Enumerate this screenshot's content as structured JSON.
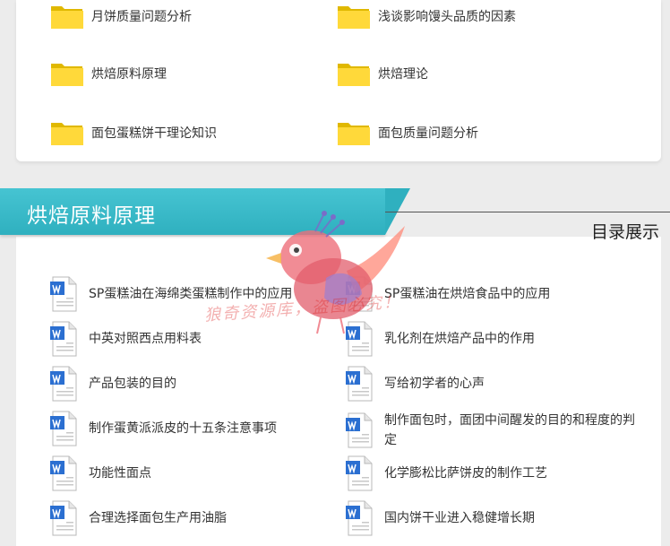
{
  "top_folders": [
    {
      "label": "月饼质量问题分析",
      "icon": "folder-icon"
    },
    {
      "label": "浅谈影响馒头品质的因素",
      "icon": "folder-icon"
    },
    {
      "label": "烘焙原料原理",
      "icon": "folder-icon"
    },
    {
      "label": "烘焙理论",
      "icon": "folder-icon"
    },
    {
      "label": "面包蛋糕饼干理论知识",
      "icon": "folder-icon"
    },
    {
      "label": "面包质量问题分析",
      "icon": "folder-icon"
    }
  ],
  "section": {
    "title": "烘焙原料原理",
    "subtitle": "目录展示",
    "accent": "#3bbbc9"
  },
  "docs": [
    {
      "label": "SP蛋糕油在海绵类蛋糕制作中的应用",
      "icon": "word-doc-icon"
    },
    {
      "label": "SP蛋糕油在烘焙食品中的应用",
      "icon": "word-doc-icon"
    },
    {
      "label": "中英对照西点用料表",
      "icon": "word-doc-icon"
    },
    {
      "label": "乳化剂在烘焙产品中的作用",
      "icon": "word-doc-icon"
    },
    {
      "label": "产品包装的目的",
      "icon": "word-doc-icon"
    },
    {
      "label": "写给初学者的心声",
      "icon": "word-doc-icon"
    },
    {
      "label": "制作蛋黄派派皮的十五条注意事项",
      "icon": "word-doc-icon"
    },
    {
      "label": "制作面包时，面团中间醒发的目的和程度的判定",
      "icon": "word-doc-icon"
    },
    {
      "label": "功能性面点",
      "icon": "word-doc-icon"
    },
    {
      "label": "化学膨松比萨饼皮的制作工艺",
      "icon": "word-doc-icon"
    },
    {
      "label": "合理选择面包生产用油脂",
      "icon": "word-doc-icon"
    },
    {
      "label": "国内饼干业进入稳健增长期",
      "icon": "word-doc-icon"
    }
  ],
  "watermark": {
    "text": "狼奇资源库，盗图必究！"
  },
  "colors": {
    "folder": "#f7d21a",
    "word_blue": "#2b6fd1"
  }
}
